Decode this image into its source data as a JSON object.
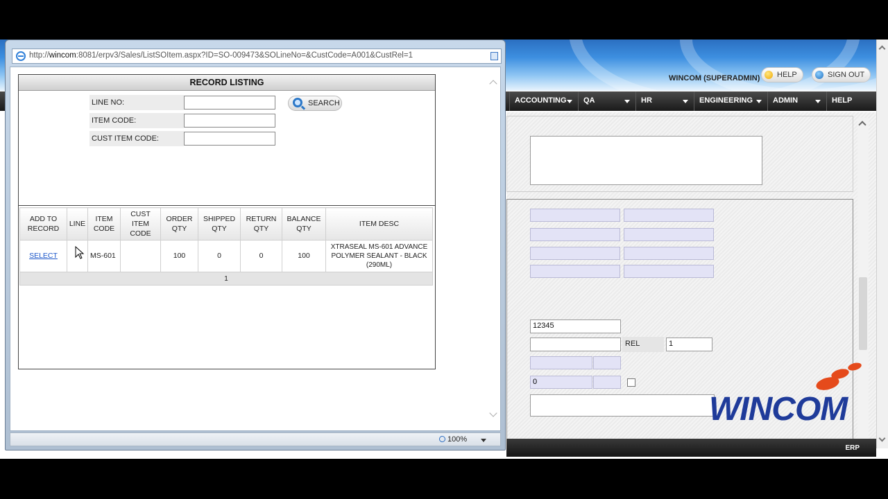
{
  "browser": {
    "url_prefix": "http://",
    "url_host": "wincom",
    "url_rest": ":8081/erpv3/Sales/ListSOItem.aspx?ID=SO-009473&SOLineNo=&CustCode=A001&CustRel=1",
    "zoom": "100%"
  },
  "header": {
    "user": "WINCOM (SUPERADMIN)",
    "help_label": "HELP",
    "signout_label": "SIGN OUT"
  },
  "menu": [
    {
      "label": "ACCOUNTING"
    },
    {
      "label": "QA"
    },
    {
      "label": "HR"
    },
    {
      "label": "ENGINEERING"
    },
    {
      "label": "ADMIN"
    },
    {
      "label": "HELP"
    }
  ],
  "background_form": {
    "value_12345": "12345",
    "rel_label": "REL",
    "rel_value": "1",
    "zero_value": "0"
  },
  "logo": "WINCOM",
  "footer": {
    "label": "ERP"
  },
  "popup": {
    "title": "RECORD LISTING",
    "fields": {
      "line_no_label": "LINE NO:",
      "item_code_label": "ITEM CODE:",
      "cust_item_code_label": "CUST ITEM CODE:"
    },
    "search_label": "SEARCH",
    "table": {
      "headers": [
        "ADD TO RECORD",
        "LINE",
        "ITEM CODE",
        "CUST ITEM CODE",
        "ORDER QTY",
        "SHIPPED QTY",
        "RETURN QTY",
        "BALANCE QTY",
        "ITEM DESC"
      ],
      "rows": [
        {
          "action": "SELECT",
          "line": "",
          "item_code": "MS-601",
          "cust_item_code": "",
          "order_qty": "100",
          "shipped_qty": "0",
          "return_qty": "0",
          "balance_qty": "100",
          "item_desc": "XTRASEAL MS-601 ADVANCE POLYMER SEALANT - BLACK (290ML)"
        }
      ],
      "pager": "1"
    }
  },
  "colors": {
    "menu_bg": "#1a1a1a",
    "header_blue": "#3d8fe0",
    "link_blue": "#1a55c8",
    "logo_blue": "#1f3b9a",
    "logo_orange": "#e54a1b"
  }
}
